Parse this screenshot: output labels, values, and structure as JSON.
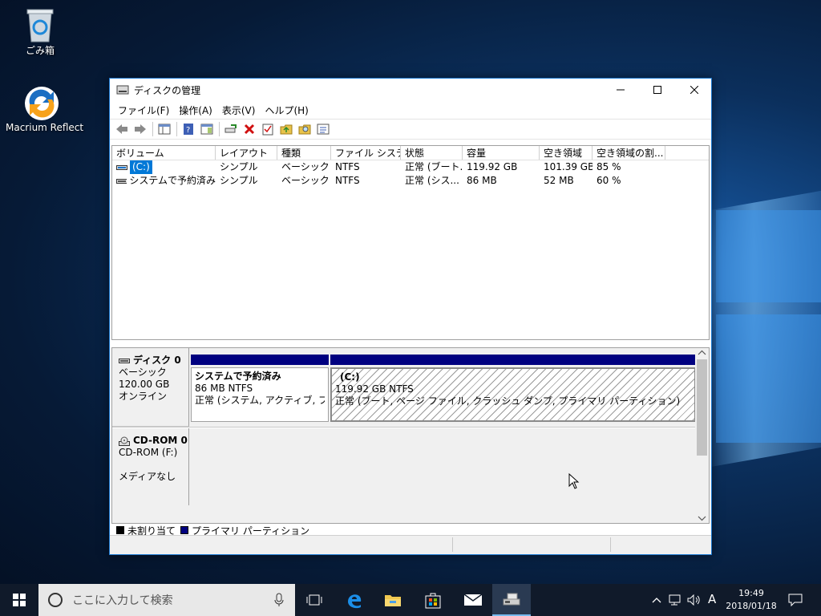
{
  "desktop": {
    "recycle_bin_label": "ごみ箱",
    "macrium_label": "Macrium Reflect"
  },
  "window": {
    "title": "ディスクの管理",
    "menu": [
      "ファイル(F)",
      "操作(A)",
      "表示(V)",
      "ヘルプ(H)"
    ]
  },
  "volumes": {
    "columns": [
      "ボリューム",
      "レイアウト",
      "種類",
      "ファイル システム",
      "状態",
      "容量",
      "空き領域",
      "空き領域の割..."
    ],
    "rows": [
      [
        "(C:)",
        "シンプル",
        "ベーシック",
        "NTFS",
        "正常 (ブート...",
        "119.92 GB",
        "101.39 GB",
        "85 %"
      ],
      [
        "システムで予約済み",
        "シンプル",
        "ベーシック",
        "NTFS",
        "正常 (シス...",
        "86 MB",
        "52 MB",
        "60 %"
      ]
    ]
  },
  "disks": {
    "disk0": {
      "name": "ディスク 0",
      "type": "ベーシック",
      "size": "120.00 GB",
      "status": "オンライン",
      "partitions": [
        {
          "name": "システムで予約済み",
          "size": "86 MB NTFS",
          "status": "正常 (システム, アクティブ, プライマ"
        },
        {
          "name": "(C:)",
          "size": "119.92 GB NTFS",
          "status": "正常 (ブート, ページ ファイル, クラッシュ ダンプ, プライマリ パーティション)"
        }
      ]
    },
    "cdrom0": {
      "name": "CD-ROM 0",
      "drive": "CD-ROM (F:)",
      "status": "メディアなし"
    }
  },
  "legend": {
    "unallocated": "未割り当て",
    "primary": "プライマリ パーティション",
    "unallocated_color": "#000000",
    "primary_color": "#000080"
  },
  "taskbar": {
    "search_placeholder": "ここに入力して検索",
    "ime": "A",
    "time": "19:49",
    "date": "2018/01/18"
  }
}
